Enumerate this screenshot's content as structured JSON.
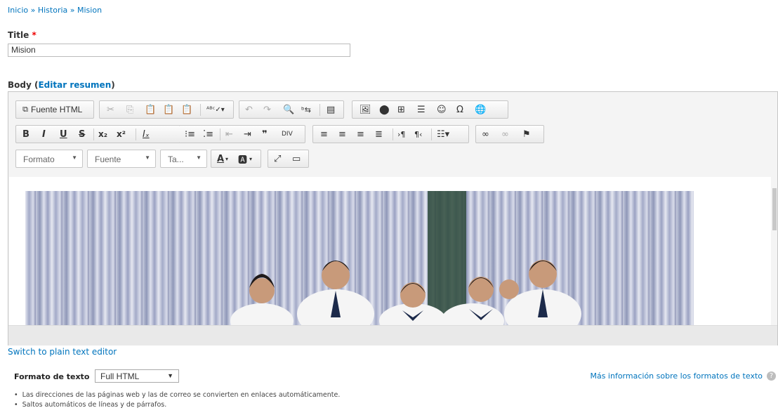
{
  "breadcrumb": {
    "items": [
      "Inicio",
      "Historia",
      "Mision"
    ],
    "separator": "»"
  },
  "title_field": {
    "label": "Title",
    "required_mark": "*",
    "value": "Mision"
  },
  "body_field": {
    "label": "Body",
    "summary_link": "Editar resumen"
  },
  "editor": {
    "toolbar_row1": {
      "source_button": "Fuente HTML",
      "icons": [
        "source-icon",
        "cut-icon",
        "copy-icon",
        "paste-icon",
        "paste-text-icon",
        "paste-word-icon",
        "spellcheck-icon",
        "undo-icon",
        "redo-icon",
        "find-icon",
        "replace-icon",
        "select-all-icon",
        "image-icon",
        "flash-icon",
        "table-icon",
        "horizontal-rule-icon",
        "smiley-icon",
        "special-char-icon",
        "iframe-icon"
      ]
    },
    "toolbar_row2": {
      "icons": [
        "bold-icon",
        "italic-icon",
        "underline-icon",
        "strike-icon",
        "subscript-icon",
        "superscript-icon",
        "remove-format-icon",
        "numbered-list-icon",
        "bulleted-list-icon",
        "outdent-icon",
        "indent-icon",
        "blockquote-icon",
        "div-icon",
        "align-left-icon",
        "align-center-icon",
        "align-right-icon",
        "justify-icon",
        "ltr-icon",
        "rtl-icon",
        "language-icon",
        "link-icon",
        "unlink-icon",
        "anchor-icon"
      ]
    },
    "toolbar_row3": {
      "format_combo": "Formato",
      "font_combo": "Fuente",
      "size_combo": "Ta...",
      "icons": [
        "text-color-icon",
        "bg-color-icon",
        "maximize-icon",
        "show-blocks-icon"
      ]
    }
  },
  "switch_editor_link": "Switch to plain text editor",
  "text_format": {
    "label": "Formato de texto",
    "selected": "Full HTML",
    "more_info": "Más información sobre los formatos de texto",
    "tips": [
      "Las direcciones de las páginas web y las de correo se convierten en enlaces automáticamente.",
      "Saltos automáticos de líneas y de párrafos."
    ]
  },
  "colors": {
    "link": "#0074bd",
    "required": "#e00000"
  }
}
